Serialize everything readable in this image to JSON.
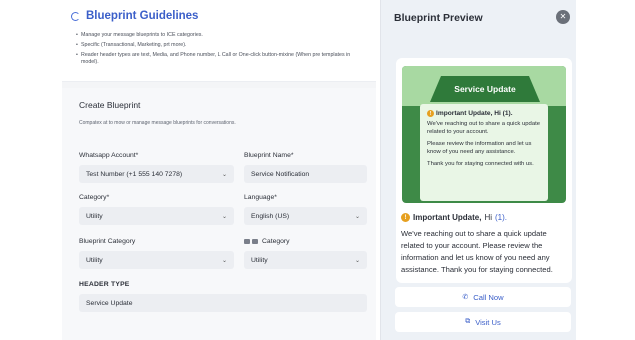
{
  "guidelines": {
    "title": "Blueprint Guidelines",
    "items": [
      "Manage your message blueprints to ICE categories.",
      "Specific (Transactional, Marketing, prt more).",
      "Reader header types are text, Media, and Phone number, L Call or One-click button-mixine (When pre templates in model)."
    ]
  },
  "create": {
    "title": "Create Blueprint",
    "subtitle": "Compatex at to mow or manage message blueprints for conversations.",
    "whatsapp_label": "Whatsapp Account*",
    "whatsapp_value": "Test Number (+1 555 140 7278)",
    "name_label": "Blueprint Name*",
    "name_value": "Service Notification",
    "category_label": "Category*",
    "category_value": "Utility",
    "language_label": "Language*",
    "language_value": "English (US)",
    "bp_category_label": "Blueprint Category",
    "bp_category_value": "Utility",
    "category2_label": "Category",
    "category2_value": "Utility",
    "header_type_label": "HEADER TYPE",
    "header_type_value": "Service Update"
  },
  "preview": {
    "title": "Blueprint Preview",
    "close": "✕",
    "banner": "Service Update",
    "card_heading": "Important Update, Hi (1).",
    "card_p1": "We've reaching out to share a quick update related to your account.",
    "card_p2": "Please review the information and let us know of you need any assistance.",
    "card_p3": "Thank you for staying connected with us.",
    "body_heading_label": "Important Update,",
    "body_heading_hi": "Hi",
    "body_heading_num": "(1).",
    "body_text": "We've reaching out to share a quick update related to your account. Please review the information and let us know of you need any assistance. Thank you for staying connected.",
    "call_now": "Call Now",
    "visit_us": "Visit Us"
  },
  "icons": {
    "warning": "!",
    "chevron": "⌄",
    "phone": "✆",
    "link": "⧉"
  },
  "colors": {
    "accent": "#3b5fc9",
    "hero_green": "#3e8a47",
    "hero_light": "#a8d9a2",
    "warning": "#e6a020"
  }
}
